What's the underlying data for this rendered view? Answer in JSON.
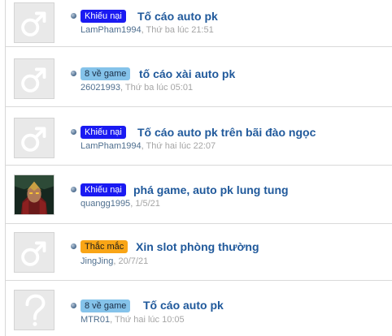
{
  "colors": {
    "accent": "#20599b",
    "prefix_complaint_bg": "#1a1af2",
    "prefix_game_bg": "#85c3ea",
    "prefix_question_bg": "#f9a516"
  },
  "threads": [
    {
      "avatar_icon": "male-symbol-icon",
      "prefix": {
        "label": "Khiếu nại",
        "bg": "#1a1af2",
        "fg": "#ffffff"
      },
      "title": "Tố cáo auto pk",
      "author": "LamPham1994",
      "separator": ",",
      "time": "Thứ ba lúc 21:51"
    },
    {
      "avatar_icon": "male-symbol-icon",
      "prefix": {
        "label": "8 về game",
        "bg": "#85c3ea",
        "fg": "#1b2f47"
      },
      "title": "tố cáo xài auto pk",
      "author": "26021993",
      "separator": ",",
      "time": "Thứ ba lúc 05:01"
    },
    {
      "avatar_icon": "male-symbol-icon",
      "prefix": {
        "label": "Khiếu nại",
        "bg": "#1a1af2",
        "fg": "#ffffff"
      },
      "title": "Tố cáo auto pk trên bãi đào ngọc",
      "author": "LamPham1994",
      "separator": ",",
      "time": "Thứ hai lúc 22:07"
    },
    {
      "avatar_icon": "user-photo-icon",
      "prefix": {
        "label": "Khiếu nại",
        "bg": "#1a1af2",
        "fg": "#ffffff"
      },
      "title": "phá game, auto pk lung tung",
      "author": "quangg1995",
      "separator": ",",
      "time": "1/5/21"
    },
    {
      "avatar_icon": "male-symbol-icon",
      "prefix": {
        "label": "Thắc mắc",
        "bg": "#f9a516",
        "fg": "#1b1b1b"
      },
      "title": "Xin slot phòng thường",
      "author": "JingJing",
      "separator": ",",
      "time": "20/7/21"
    },
    {
      "avatar_icon": "question-mark-icon",
      "prefix": {
        "label": "8 về game",
        "bg": "#85c3ea",
        "fg": "#1b2f47"
      },
      "title": "Tố cáo auto pk",
      "author": "MTR01",
      "separator": ",",
      "time": "Thứ hai lúc 10:05"
    }
  ]
}
